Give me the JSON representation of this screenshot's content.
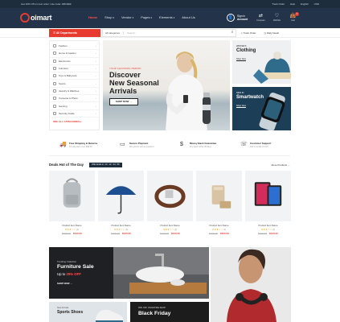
{
  "topbar": {
    "left_text": "Get 10% Off on next order. Use code: ABCDEF",
    "links": [
      "Track Order",
      "Help",
      "English",
      "USD"
    ]
  },
  "header": {
    "logo_text": "oimart",
    "nav": [
      {
        "label": "Home",
        "active": true,
        "dropdown": false
      },
      {
        "label": "Shop",
        "active": false,
        "dropdown": true
      },
      {
        "label": "Vendor",
        "active": false,
        "dropdown": true
      },
      {
        "label": "Pages",
        "active": false,
        "dropdown": true
      },
      {
        "label": "Elements",
        "active": false,
        "dropdown": true
      },
      {
        "label": "About Us",
        "active": false,
        "dropdown": false
      }
    ],
    "account_line1": "Sign in",
    "account_line2": "Account",
    "icons": [
      {
        "name": "compare-icon",
        "glyph": "⇄",
        "label": "Compare",
        "badge": ""
      },
      {
        "name": "wishlist-icon",
        "glyph": "♡",
        "label": "Wishlist",
        "badge": ""
      },
      {
        "name": "cart-icon",
        "glyph": "👜",
        "label": "Cart",
        "badge": "0"
      }
    ],
    "accent_color": "#e63b2e",
    "bg_color": "#23344a"
  },
  "category_bar": {
    "button_label": "All Departments",
    "search_category": "All categories",
    "search_placeholder": "Search...",
    "links": [
      "Track Order",
      "Daily Deals"
    ]
  },
  "sidebar": {
    "items": [
      "Fashion",
      "Home & Garden",
      "Electronics",
      "Furniture",
      "Toys & Babycare",
      "Sports",
      "Jewelry & Watches",
      "Cameras & Photo",
      "Gaming",
      "Security Guide"
    ],
    "all_label": "SEE ALL CATEGORIES ▸"
  },
  "hero": {
    "eyebrow": "YOUR CHOOSING PERIOD",
    "title_line1": "Discover",
    "title_line2": "New Seasonal",
    "title_line3": "Arrivals",
    "cta": "SHOP NOW →"
  },
  "side_banners": [
    {
      "small": "WINTER'S",
      "big": "Clothing",
      "link": "Shop Now"
    },
    {
      "small": "NEW IN",
      "big": "Smartwatch",
      "link": "Shop Now"
    }
  ],
  "features": [
    {
      "icon": "truck-icon",
      "glyph": "🚚",
      "title": "Free Shipping & Returns",
      "sub": "For all orders over $99.00"
    },
    {
      "icon": "card-icon",
      "glyph": "▭",
      "title": "Secure Payment",
      "sub": "We ensure secure payment"
    },
    {
      "icon": "money-icon",
      "glyph": "$",
      "title": "Money Back Guarantee",
      "sub": "Any back within 30 days"
    },
    {
      "icon": "chat-icon",
      "glyph": "☏",
      "title": "Customer Support",
      "sub": "Call or email us 24/7"
    }
  ],
  "deals": {
    "title": "Deals Hot of The Day",
    "timer": "Offer Ends in: 10 : 12 : 34 : 56",
    "more": "More Products →"
  },
  "products": [
    {
      "name": "Product Item Name",
      "rating": "★★★☆☆",
      "reviews": "(3)",
      "old_price": "$199.00",
      "price": "$120.00",
      "image": "backpack"
    },
    {
      "name": "Product Item Name",
      "rating": "★★★☆☆",
      "reviews": "(3)",
      "old_price": "$199.00",
      "price": "$120.00",
      "image": "umbrella"
    },
    {
      "name": "Product Item Name",
      "rating": "★★★☆☆",
      "reviews": "(3)",
      "old_price": "$199.00",
      "price": "$120.00",
      "image": "belt"
    },
    {
      "name": "Product Item Name",
      "rating": "★★★☆☆",
      "reviews": "(3)",
      "old_price": "$199.00",
      "price": "$120.00",
      "image": "cardholder"
    },
    {
      "name": "Product Item Name",
      "rating": "★★★☆☆",
      "reviews": "(3)",
      "old_price": "$199.00",
      "price": "$120.00",
      "image": "tablets"
    }
  ],
  "promos": {
    "furniture": {
      "small": "Trending Collection",
      "big": "Furniture Sale",
      "off_prefix": "Up to ",
      "off_value": "25% OFF",
      "cta": "SHOP NOW →"
    },
    "sports": {
      "small": "New Arrivals",
      "big": "Sports Shoes"
    },
    "friday": {
      "small": "35% OFF ON ENTIRE SHOP",
      "big": "Black Friday"
    }
  }
}
